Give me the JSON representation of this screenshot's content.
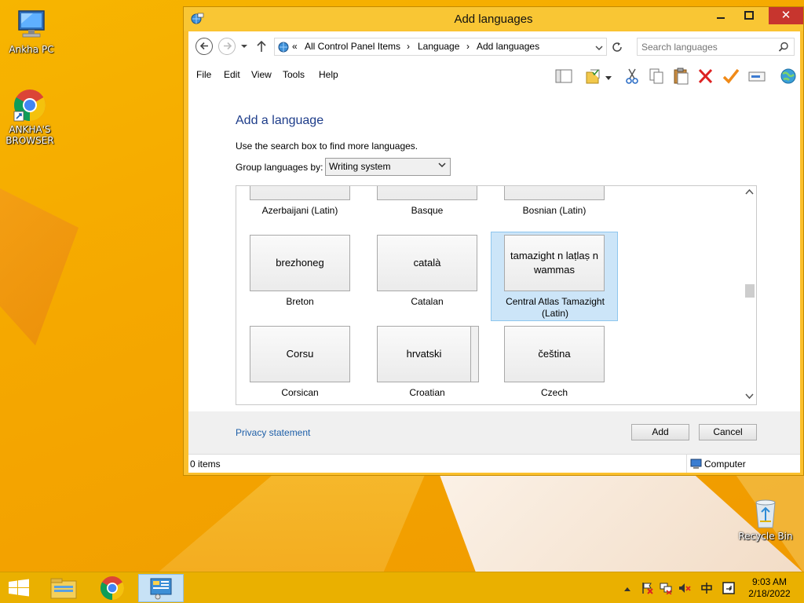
{
  "desktop": {
    "icons": [
      {
        "label": "Ankha PC"
      },
      {
        "label": "ANKHA'S BROWSER"
      },
      {
        "label": "Recycle Bin"
      }
    ]
  },
  "window": {
    "title": "Add languages",
    "close_glyph": "✕",
    "address": {
      "prefix": "«",
      "crumbs": [
        "All Control Panel Items",
        "Language",
        "Add languages"
      ],
      "separator": "›"
    },
    "search": {
      "placeholder": "Search languages"
    },
    "menu": [
      "File",
      "Edit",
      "View",
      "Tools",
      "Help"
    ],
    "content": {
      "heading": "Add a language",
      "hint": "Use the search box to find more languages.",
      "group_label": "Group languages by:",
      "group_value": "Writing system",
      "languages": [
        {
          "native": "",
          "caption": "Azerbaijani (Latin)"
        },
        {
          "native": "",
          "caption": "Basque"
        },
        {
          "native": "",
          "caption": "Bosnian (Latin)"
        },
        {
          "native": "brezhoneg",
          "caption": "Breton"
        },
        {
          "native": "català",
          "caption": "Catalan"
        },
        {
          "native": "tamazight n laṭlaṣ n wammas",
          "caption": "Central Atlas Tamazight (Latin)",
          "selected": true
        },
        {
          "native": "Corsu",
          "caption": "Corsican"
        },
        {
          "native": "hrvatski",
          "caption": "Croatian"
        },
        {
          "native": "čeština",
          "caption": "Czech"
        }
      ]
    },
    "footer": {
      "privacy": "Privacy statement",
      "add": "Add",
      "cancel": "Cancel"
    },
    "status": {
      "items": "0 items",
      "location": "Computer"
    }
  },
  "taskbar": {
    "time": "9:03 AM",
    "date": "2/18/2022"
  },
  "colors": {
    "desktop": "#f7b500",
    "frame": "#fbc02d",
    "close": "#c7352e",
    "selection": "#cce5f8",
    "link": "#1e5fa8"
  }
}
